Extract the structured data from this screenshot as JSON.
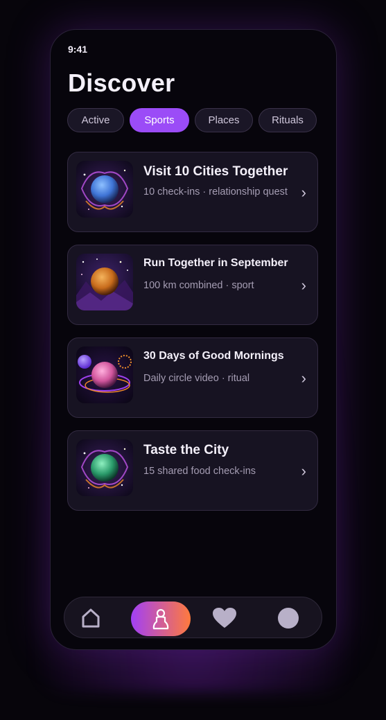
{
  "status_bar": {
    "time": "9:41"
  },
  "header": {
    "title": "Discover"
  },
  "filters": [
    {
      "label": "Active",
      "active": false
    },
    {
      "label": "Sports",
      "active": true
    },
    {
      "label": "Places",
      "active": false
    },
    {
      "label": "Rituals",
      "active": false
    }
  ],
  "quests": [
    {
      "title": "Visit 10 Cities Together",
      "subtitle": "10 check-ins · relationship quest",
      "orb_color": "#4a86e8"
    },
    {
      "title": "Run Together in September",
      "subtitle": "100 km combined · sport",
      "orb_color": "#e08a2a"
    },
    {
      "title": "30 Days of Good Mornings",
      "subtitle": "Daily circle video · ritual",
      "orb_color": "#e070b0"
    },
    {
      "title": "Taste the City",
      "subtitle": "15 shared food check-ins",
      "orb_color": "#2fb07a"
    }
  ],
  "nav": {
    "items": [
      {
        "icon": "home-icon"
      },
      {
        "icon": "person-icon",
        "active": true
      },
      {
        "icon": "heart-icon"
      },
      {
        "icon": "profile-icon"
      }
    ]
  },
  "colors": {
    "accent": "#9b4cf7",
    "gradient_end": "#ff7a3d",
    "background": "#07050c"
  }
}
